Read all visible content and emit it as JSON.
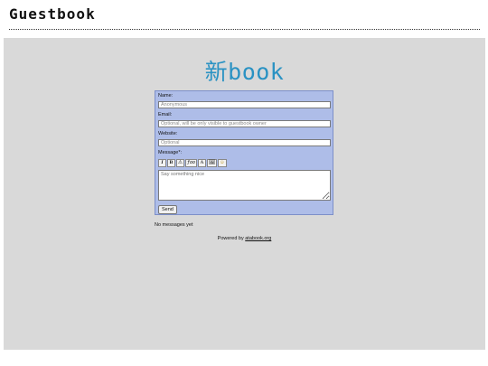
{
  "page": {
    "title": "Guestbook"
  },
  "logo": {
    "text": "新book"
  },
  "form": {
    "name_label": "Name:",
    "name_placeholder": "Anonymous",
    "email_label": "Email:",
    "email_placeholder": "Optional, will be only visible to guestbook owner",
    "website_label": "Website:",
    "website_placeholder": "Optional",
    "message_label": "Message*:",
    "message_placeholder": "Say something nice",
    "toolbar": {
      "italic": "I",
      "bold": "B",
      "warning_icon": "⚠",
      "mono": "ƒoo",
      "font_icon": "A",
      "image_icon": "🖼",
      "smiley_icon": "☺"
    },
    "send_label": "Send"
  },
  "messages": {
    "empty_text": "No messages yet"
  },
  "footer": {
    "prefix": "Powered by",
    "link_text": "atabook.org"
  }
}
